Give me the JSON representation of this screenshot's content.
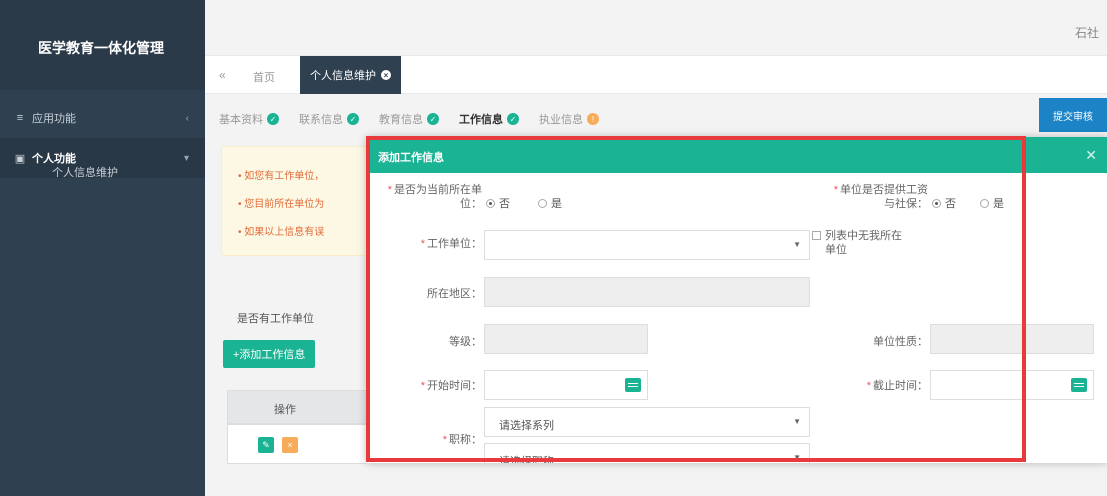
{
  "app": {
    "title": "医学教育一体化管理"
  },
  "sidebar": {
    "items": [
      {
        "label": "应用功能",
        "icon": "list-icon"
      },
      {
        "label": "个人功能",
        "icon": "grid-icon",
        "expanded": true,
        "children": [
          {
            "label": "个人信息维护"
          }
        ]
      }
    ]
  },
  "header": {
    "user_label": "石社"
  },
  "tabs": {
    "back_icon": "double-chevron-left-icon",
    "home": "首页",
    "active": "个人信息维护"
  },
  "steps": [
    {
      "label": "基本资料",
      "status": "done"
    },
    {
      "label": "联系信息",
      "status": "done"
    },
    {
      "label": "教育信息",
      "status": "done"
    },
    {
      "label": "工作信息",
      "status": "current-done"
    },
    {
      "label": "执业信息",
      "status": "warning"
    }
  ],
  "top_right_button": "提交审核",
  "notices": [
    "如您有工作单位，",
    "您目前所在单位为",
    "如果以上信息有误"
  ],
  "section_title": "是否有工作单位",
  "add_button": "+添加工作信息",
  "table": {
    "header": "操作"
  },
  "modal": {
    "title": "添加工作信息",
    "current_unit": {
      "label_1": "是否为当前所在单",
      "label_2": "位：",
      "options": [
        "否",
        "是"
      ],
      "selected": "否"
    },
    "social_insurance": {
      "label_1": "单位是否提供工资",
      "label_2": "与社保：",
      "options": [
        "否",
        "是"
      ],
      "selected": "否"
    },
    "work_unit": {
      "label": "工作单位：",
      "value": ""
    },
    "not_in_list": {
      "label_1": "列表中无我所在",
      "label_2": "单位",
      "checked": false
    },
    "region": {
      "label": "所在地区：",
      "value": ""
    },
    "grade": {
      "label": "等级：",
      "value": ""
    },
    "unit_nature": {
      "label": "单位性质：",
      "value": ""
    },
    "start_time": {
      "label": "开始时间：",
      "value": ""
    },
    "end_time": {
      "label": "截止时间：",
      "value": ""
    },
    "title_field": {
      "label": "职称：",
      "series_placeholder": "请选择系列",
      "second_placeholder": "请选择职称"
    }
  },
  "colors": {
    "sidebar": "#2f4050",
    "accent": "#1ab394",
    "highlight": "#e8393c",
    "blue": "#1c84c6"
  }
}
